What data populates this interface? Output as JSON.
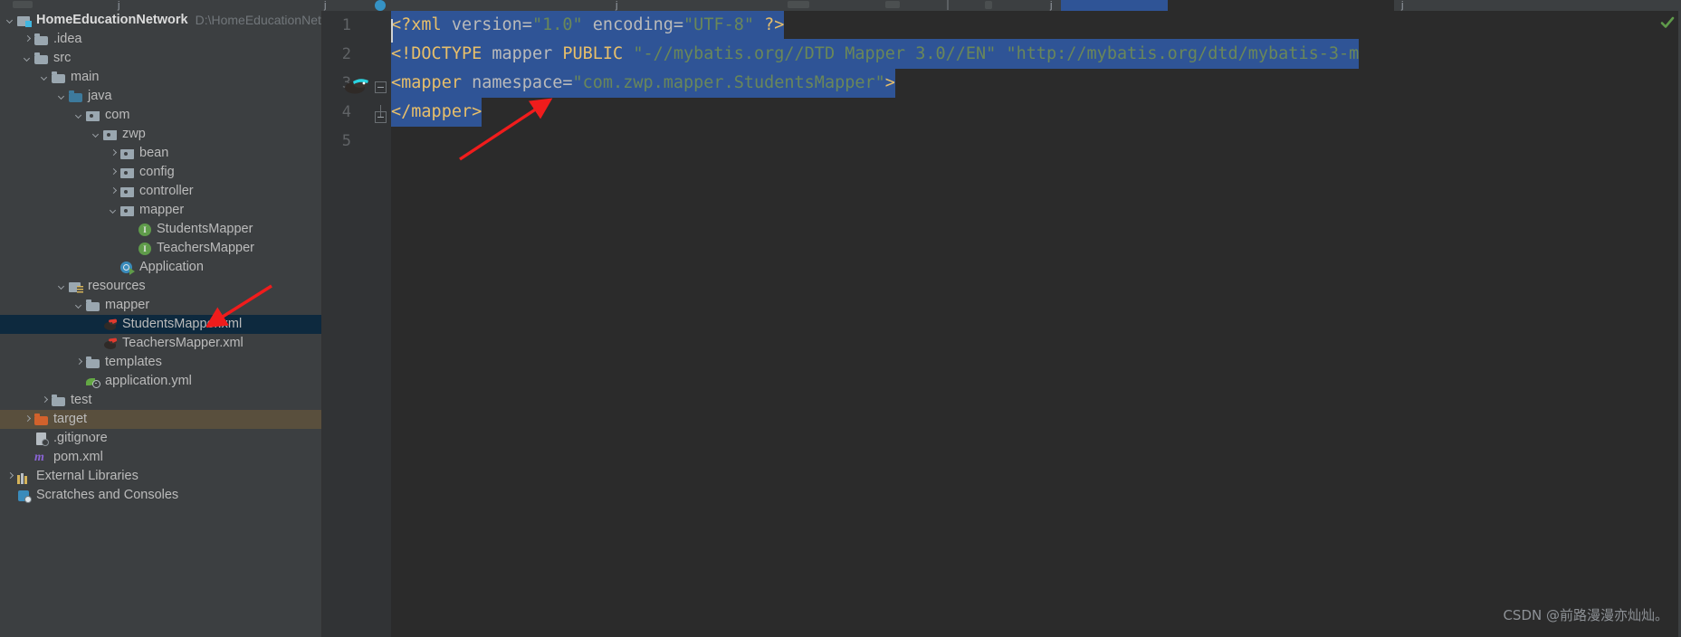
{
  "toolbar": {
    "icons": [
      "window-icon",
      "j-glyph",
      "j-glyph",
      "build-icon",
      "run-icon",
      "debug-icon",
      "divider",
      "search-icon",
      "j-glyph",
      "circle-icon",
      "j-glyph"
    ]
  },
  "project_tree": {
    "root": {
      "label": "HomeEducationNetwork",
      "path_hint": "D:\\HomeEducationNetwo",
      "icon": "module-icon",
      "expanded": true
    },
    "items": [
      {
        "label": ".idea",
        "icon": "folder-icon",
        "indent": 1,
        "arrow": "right",
        "state": "normal"
      },
      {
        "label": "src",
        "icon": "folder-icon",
        "indent": 1,
        "arrow": "down",
        "state": "normal"
      },
      {
        "label": "main",
        "icon": "folder-icon",
        "indent": 2,
        "arrow": "down",
        "state": "normal"
      },
      {
        "label": "java",
        "icon": "source-folder-icon",
        "indent": 3,
        "arrow": "down",
        "state": "normal"
      },
      {
        "label": "com",
        "icon": "package-icon",
        "indent": 4,
        "arrow": "down",
        "state": "normal"
      },
      {
        "label": "zwp",
        "icon": "package-icon",
        "indent": 5,
        "arrow": "down",
        "state": "normal"
      },
      {
        "label": "bean",
        "icon": "package-icon",
        "indent": 6,
        "arrow": "right",
        "state": "normal"
      },
      {
        "label": "config",
        "icon": "package-icon",
        "indent": 6,
        "arrow": "right",
        "state": "normal"
      },
      {
        "label": "controller",
        "icon": "package-icon",
        "indent": 6,
        "arrow": "right",
        "state": "normal"
      },
      {
        "label": "mapper",
        "icon": "package-icon",
        "indent": 6,
        "arrow": "down",
        "state": "normal"
      },
      {
        "label": "StudentsMapper",
        "icon": "interface-icon",
        "indent": 7,
        "arrow": "none",
        "state": "normal"
      },
      {
        "label": "TeachersMapper",
        "icon": "interface-icon",
        "indent": 7,
        "arrow": "none",
        "state": "normal"
      },
      {
        "label": "Application",
        "icon": "spring-app-icon",
        "indent": 6,
        "arrow": "none",
        "state": "normal"
      },
      {
        "label": "resources",
        "icon": "resources-folder-icon",
        "indent": 3,
        "arrow": "down",
        "state": "normal"
      },
      {
        "label": "mapper",
        "icon": "folder-icon",
        "indent": 4,
        "arrow": "down",
        "state": "normal"
      },
      {
        "label": "StudentsMapper.xml",
        "icon": "mybatis-file-icon",
        "indent": 5,
        "arrow": "none",
        "state": "selected"
      },
      {
        "label": "TeachersMapper.xml",
        "icon": "mybatis-file-icon",
        "indent": 5,
        "arrow": "none",
        "state": "normal"
      },
      {
        "label": "templates",
        "icon": "folder-icon",
        "indent": 4,
        "arrow": "right",
        "state": "normal"
      },
      {
        "label": "application.yml",
        "icon": "yml-file-icon",
        "indent": 4,
        "arrow": "none",
        "state": "normal"
      },
      {
        "label": "test",
        "icon": "folder-icon",
        "indent": 2,
        "arrow": "right",
        "state": "normal"
      },
      {
        "label": "target",
        "icon": "excluded-folder-icon",
        "indent": 1,
        "arrow": "right",
        "state": "excluded"
      },
      {
        "label": ".gitignore",
        "icon": "file-icon",
        "indent": 1,
        "arrow": "none",
        "state": "normal"
      },
      {
        "label": "pom.xml",
        "icon": "maven-icon",
        "indent": 1,
        "arrow": "none",
        "state": "normal"
      },
      {
        "label": "External Libraries",
        "icon": "libraries-icon",
        "indent": 0,
        "arrow": "right",
        "state": "normal"
      },
      {
        "label": "Scratches and Consoles",
        "icon": "scratches-icon",
        "indent": 0,
        "arrow": "none",
        "state": "normal"
      }
    ]
  },
  "editor": {
    "filename": "StudentsMapper.xml",
    "gutter_line_numbers": [
      "1",
      "2",
      "3",
      "4",
      "5"
    ],
    "gutter_icon_line": 3,
    "gutter_icon_name": "mybatis-gutter-icon",
    "inspection_status_icon": "inspection-ok-check-icon",
    "lines": [
      {
        "number": "1",
        "selected": true,
        "tokens": [
          {
            "t": "<?xml",
            "c": "tag"
          },
          {
            "t": " ",
            "c": "plain"
          },
          {
            "t": "version=",
            "c": "attr"
          },
          {
            "t": "\"1.0\"",
            "c": "val"
          },
          {
            "t": " ",
            "c": "plain"
          },
          {
            "t": "encoding=",
            "c": "attr"
          },
          {
            "t": "\"UTF-8\"",
            "c": "val"
          },
          {
            "t": " ",
            "c": "plain"
          },
          {
            "t": "?>",
            "c": "tag"
          }
        ]
      },
      {
        "number": "2",
        "selected": true,
        "tokens": [
          {
            "t": "<!DOCTYPE",
            "c": "tag"
          },
          {
            "t": " mapper ",
            "c": "attr"
          },
          {
            "t": "PUBLIC",
            "c": "tag"
          },
          {
            "t": " ",
            "c": "plain"
          },
          {
            "t": "\"-//mybatis.org//DTD Mapper 3.0//EN\"",
            "c": "val"
          },
          {
            "t": " ",
            "c": "plain"
          },
          {
            "t": "\"http://mybatis.org/dtd/mybatis-3-m",
            "c": "val"
          }
        ]
      },
      {
        "number": "3",
        "selected": true,
        "tokens": [
          {
            "t": "<mapper",
            "c": "tag"
          },
          {
            "t": " ",
            "c": "plain"
          },
          {
            "t": "namespace=",
            "c": "attr"
          },
          {
            "t": "\"com.zwp.mapper.StudentsMapper\"",
            "c": "val"
          },
          {
            "t": ">",
            "c": "tag"
          }
        ]
      },
      {
        "number": "4",
        "selected": true,
        "tokens": [
          {
            "t": "</mapper>",
            "c": "tag"
          }
        ]
      },
      {
        "number": "5",
        "selected": false,
        "tokens": []
      }
    ]
  },
  "annotations": [
    {
      "name": "arrow-to-doctype-end",
      "color": "#f01c1c"
    },
    {
      "name": "arrow-to-selected-file",
      "color": "#f01c1c"
    }
  ],
  "watermark": {
    "text": "CSDN @前路漫漫亦灿灿。"
  },
  "colors": {
    "panel_bg": "#3c3f41",
    "editor_bg": "#2b2b2b",
    "gutter_bg": "#313335",
    "selection_blue": "#2f5496",
    "tree_selection": "#0d293e",
    "excluded_row": "#594f3d",
    "tag": "#e8bf6a",
    "string_value": "#6a8759",
    "attr": "#bababa",
    "annotation_red": "#f01c1c"
  }
}
